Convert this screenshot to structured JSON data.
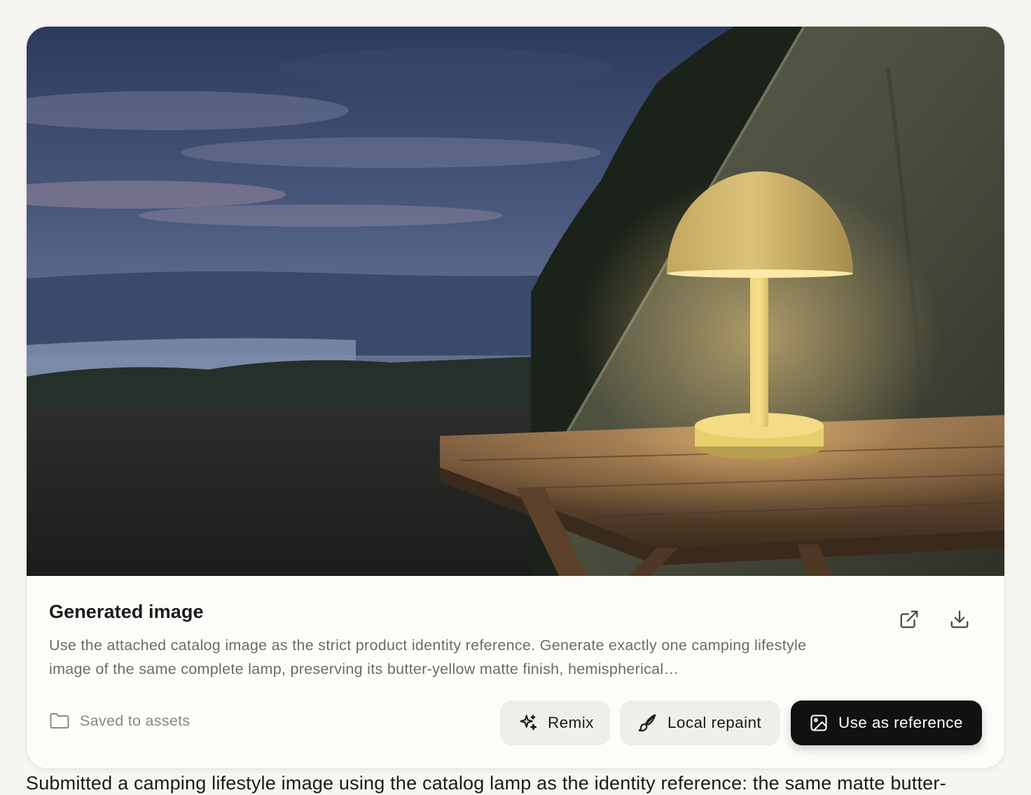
{
  "card": {
    "title": "Generated image",
    "description": "Use the attached catalog image as the strict product identity reference. Generate exactly one camping lifestyle image of the same complete lamp, preserving its butter-yellow matte finish, hemispherical…",
    "saved_label": "Saved to assets",
    "open_icon": "external-link-icon",
    "download_icon": "download-icon",
    "folder_icon": "folder-icon"
  },
  "actions": {
    "remix_label": "Remix",
    "remix_icon": "sparkles-icon",
    "repaint_label": "Local repaint",
    "repaint_icon": "paintbrush-icon",
    "reference_label": "Use as reference",
    "reference_icon": "image-icon"
  },
  "footer": {
    "text": "Submitted a camping lifestyle image using the catalog lamp as the identity reference: the same matte butter-"
  },
  "colors": {
    "page_bg": "#f6f5f1",
    "card_bg": "#fdfcf9",
    "primary_button": "#111111",
    "secondary_button": "#f0eeea",
    "lamp_yellow": "#e8cf6e"
  }
}
